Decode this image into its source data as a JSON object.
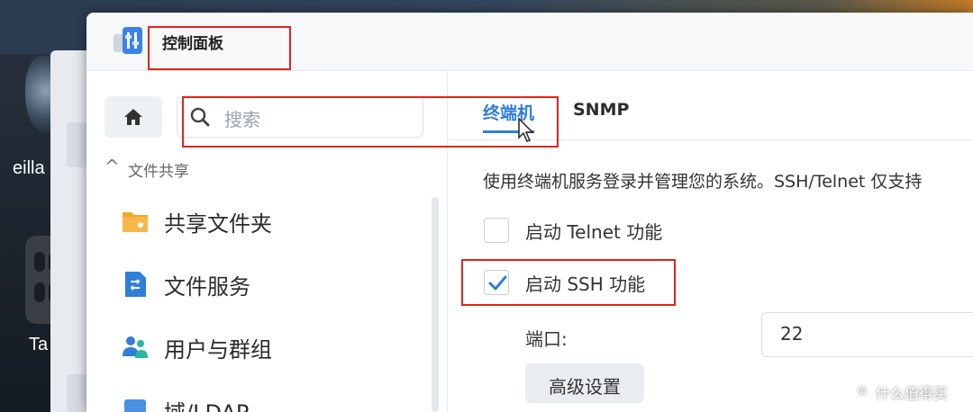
{
  "window": {
    "title": "控制面板"
  },
  "desktop": {
    "labels": [
      "eilla",
      "Ta"
    ]
  },
  "sidebar": {
    "search_placeholder": "搜索",
    "section": "文件共享",
    "items": [
      {
        "label": "共享文件夹",
        "icon": "shared-folder-icon"
      },
      {
        "label": "文件服务",
        "icon": "file-services-icon"
      },
      {
        "label": "用户与群组",
        "icon": "users-groups-icon"
      },
      {
        "label": "域/LDAP",
        "icon": "domain-ldap-icon"
      }
    ]
  },
  "tabs": [
    {
      "label": "终端机",
      "active": true
    },
    {
      "label": "SNMP",
      "active": false
    }
  ],
  "content": {
    "description": "使用终端机服务登录并管理您的系统。SSH/Telnet 仅支持",
    "telnet_label": "启动 Telnet 功能",
    "telnet_checked": false,
    "ssh_label": "启动 SSH 功能",
    "ssh_checked": true,
    "port_label": "端口:",
    "port_value": "22",
    "advanced_button": "高级设置"
  },
  "watermark": "什么值得买",
  "colors": {
    "accent": "#2f7fd6",
    "annotation": "#e0241e"
  }
}
